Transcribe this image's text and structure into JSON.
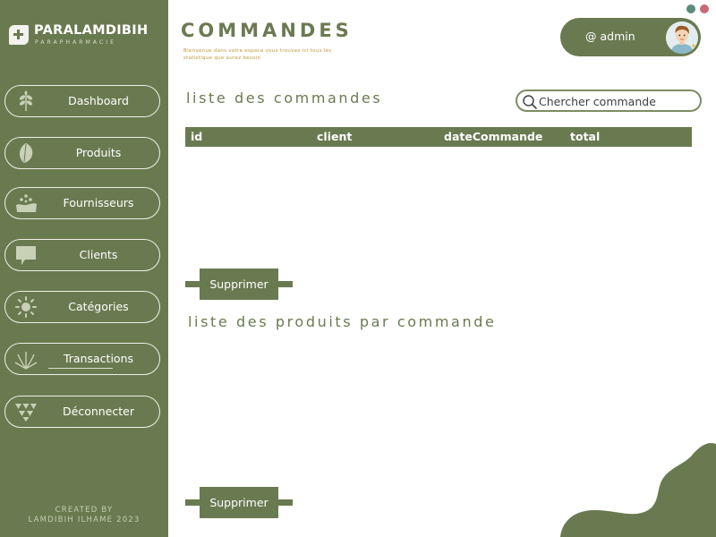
{
  "brand": {
    "name": "PARALAMDIBIH",
    "tagline": "PARAPHARMACIE"
  },
  "sidebar": {
    "items": [
      {
        "label": "Dashboard",
        "icon": "leaf-sprig-icon"
      },
      {
        "label": "Produits",
        "icon": "leaf-icon"
      },
      {
        "label": "Fournisseurs",
        "icon": "hand-drops-icon"
      },
      {
        "label": "Clients",
        "icon": "chat-bubble-icon"
      },
      {
        "label": "Catégories",
        "icon": "sun-icon"
      },
      {
        "label": "Transactions",
        "icon": "palm-leaves-icon"
      },
      {
        "label": "Déconnecter",
        "icon": "triangles-icon"
      }
    ],
    "credit_line1": "CREATED BY",
    "credit_line2": "LAMDIBIH ILHAME 2023"
  },
  "header": {
    "title": "COMMANDES",
    "subtitle": "Bienvenue dans votre espace vous trouvez ici tous les statistique que aurez besoin"
  },
  "user": {
    "label": "@ admin"
  },
  "window_dots": [
    "#5f8a7a",
    "#c86a78"
  ],
  "orders": {
    "title": "liste des commandes",
    "search_placeholder": "Chercher commande",
    "search_value": "",
    "columns": [
      "id",
      "client",
      "dateCommande",
      "total"
    ],
    "rows": [],
    "delete_label": "Supprimer"
  },
  "products": {
    "title": "liste des produits par commande",
    "rows": [],
    "delete_label": "Supprimer"
  },
  "colors": {
    "primary": "#6a7a50",
    "accent": "#c0983a",
    "background": "#ffffff"
  }
}
